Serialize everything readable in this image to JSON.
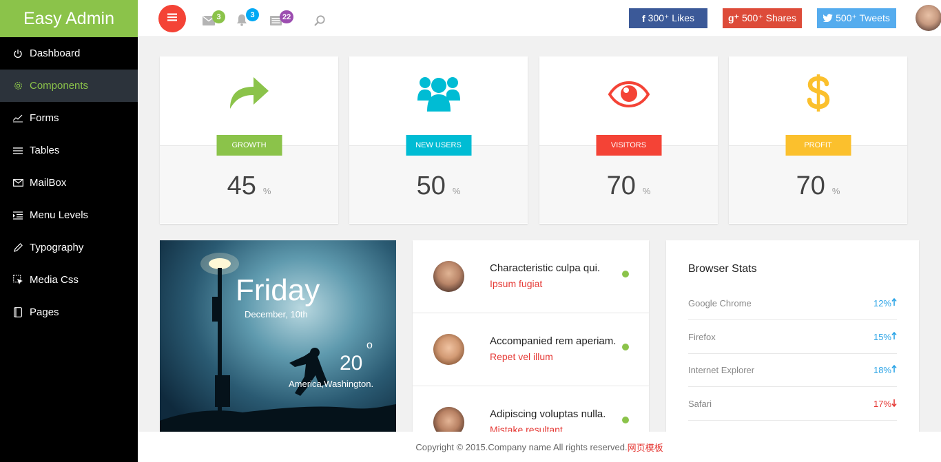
{
  "brand": {
    "title": "Easy Admin"
  },
  "sidebar": {
    "items": [
      {
        "label": "Dashboard",
        "icon": "power-icon"
      },
      {
        "label": "Components",
        "icon": "gear-icon"
      },
      {
        "label": "Forms",
        "icon": "chart-icon"
      },
      {
        "label": "Tables",
        "icon": "list-icon"
      },
      {
        "label": "MailBox",
        "icon": "mail-icon"
      },
      {
        "label": "Menu Levels",
        "icon": "indent-icon"
      },
      {
        "label": "Typography",
        "icon": "pencil-icon"
      },
      {
        "label": "Media Css",
        "icon": "cursor-icon"
      },
      {
        "label": "Pages",
        "icon": "book-icon"
      }
    ],
    "active_index": 1
  },
  "header": {
    "mail_badge": "3",
    "bell_badge": "3",
    "news_badge": "22",
    "social": {
      "likes": "300⁺ Likes",
      "likes_icon": "f",
      "shares": "500⁺ Shares",
      "shares_icon": "g⁺",
      "tweets": "500⁺ Tweets"
    }
  },
  "stats": [
    {
      "label": "GROWTH",
      "value": "45",
      "unit": "%",
      "color": "#8bc34a"
    },
    {
      "label": "NEW USERS",
      "value": "50",
      "unit": "%",
      "color": "#00bcd4"
    },
    {
      "label": "VISITORS",
      "value": "70",
      "unit": "%",
      "color": "#f44336"
    },
    {
      "label": "PROFIT",
      "value": "70",
      "unit": "%",
      "color": "#fbc02d"
    }
  ],
  "weather": {
    "day": "Friday",
    "date": "December, 10th",
    "temp": "20",
    "degree": "o",
    "location": "America,Washington."
  },
  "messages": [
    {
      "title": "Characteristic culpa qui.",
      "subtitle": "Ipsum fugiat"
    },
    {
      "title": "Accompanied rem aperiam.",
      "subtitle": "Repet vel illum"
    },
    {
      "title": "Adipiscing voluptas nulla.",
      "subtitle": "Mistake resultant"
    }
  ],
  "browser_stats": {
    "title": "Browser Stats",
    "rows": [
      {
        "name": "Google Chrome",
        "value": "12%",
        "trend": "up",
        "color": "#29a3e6"
      },
      {
        "name": "Firefox",
        "value": "15%",
        "trend": "up",
        "color": "#29a3e6"
      },
      {
        "name": "Internet Explorer",
        "value": "18%",
        "trend": "up",
        "color": "#29a3e6"
      },
      {
        "name": "Safari",
        "value": "17%",
        "trend": "down",
        "color": "#e53935"
      }
    ]
  },
  "footer": {
    "text": "Copyright © 2015.Company name All rights reserved.",
    "link": "网页模板"
  },
  "colors": {
    "green": "#8bc34a",
    "cyan": "#00bcd4",
    "red": "#f44336",
    "yellow": "#fbc02d",
    "facebook": "#3b5998",
    "google": "#dd4b39",
    "twitter": "#55acee"
  }
}
